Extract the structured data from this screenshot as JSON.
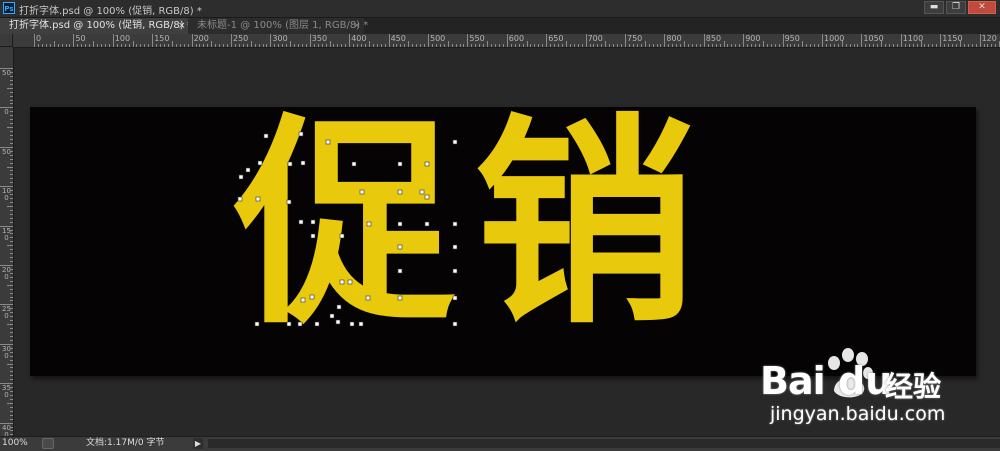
{
  "app": {
    "logo_text": "Ps",
    "window_title": "打折字体.psd @ 100% (促销, RGB/8) *"
  },
  "window_controls": {
    "minimize": "▬",
    "restore": "❐",
    "close": "✕"
  },
  "tabs": [
    {
      "label": "打折字体.psd @ 100% (促销, RGB/8) *",
      "close": "×"
    },
    {
      "label": "未标题-1 @ 100% (图层 1, RGB/8) *",
      "close": "×"
    }
  ],
  "ruler_h_labels": [
    "0",
    "50",
    "100",
    "150",
    "200",
    "250",
    "300",
    "350",
    "400",
    "450",
    "500",
    "550",
    "600",
    "650",
    "700",
    "750",
    "800",
    "850",
    "900",
    "950",
    "1000",
    "1050",
    "1100",
    "1150",
    "120"
  ],
  "ruler_v_labels": [
    "50",
    "0",
    "50",
    "100",
    "150",
    "200",
    "250",
    "300",
    "350",
    "400"
  ],
  "canvas": {
    "text_layer": [
      "促",
      "销"
    ],
    "text_color": "#e8c90c",
    "background_color": "#050304"
  },
  "status": {
    "zoom": "100%",
    "doc_info": "文档:1.17M/0 字节",
    "menu_arrow": "▶"
  },
  "watermark": {
    "brand_bai": "Bai",
    "brand_du": "du",
    "brand_jy": "经验",
    "url": "jingyan.baidu.com"
  }
}
